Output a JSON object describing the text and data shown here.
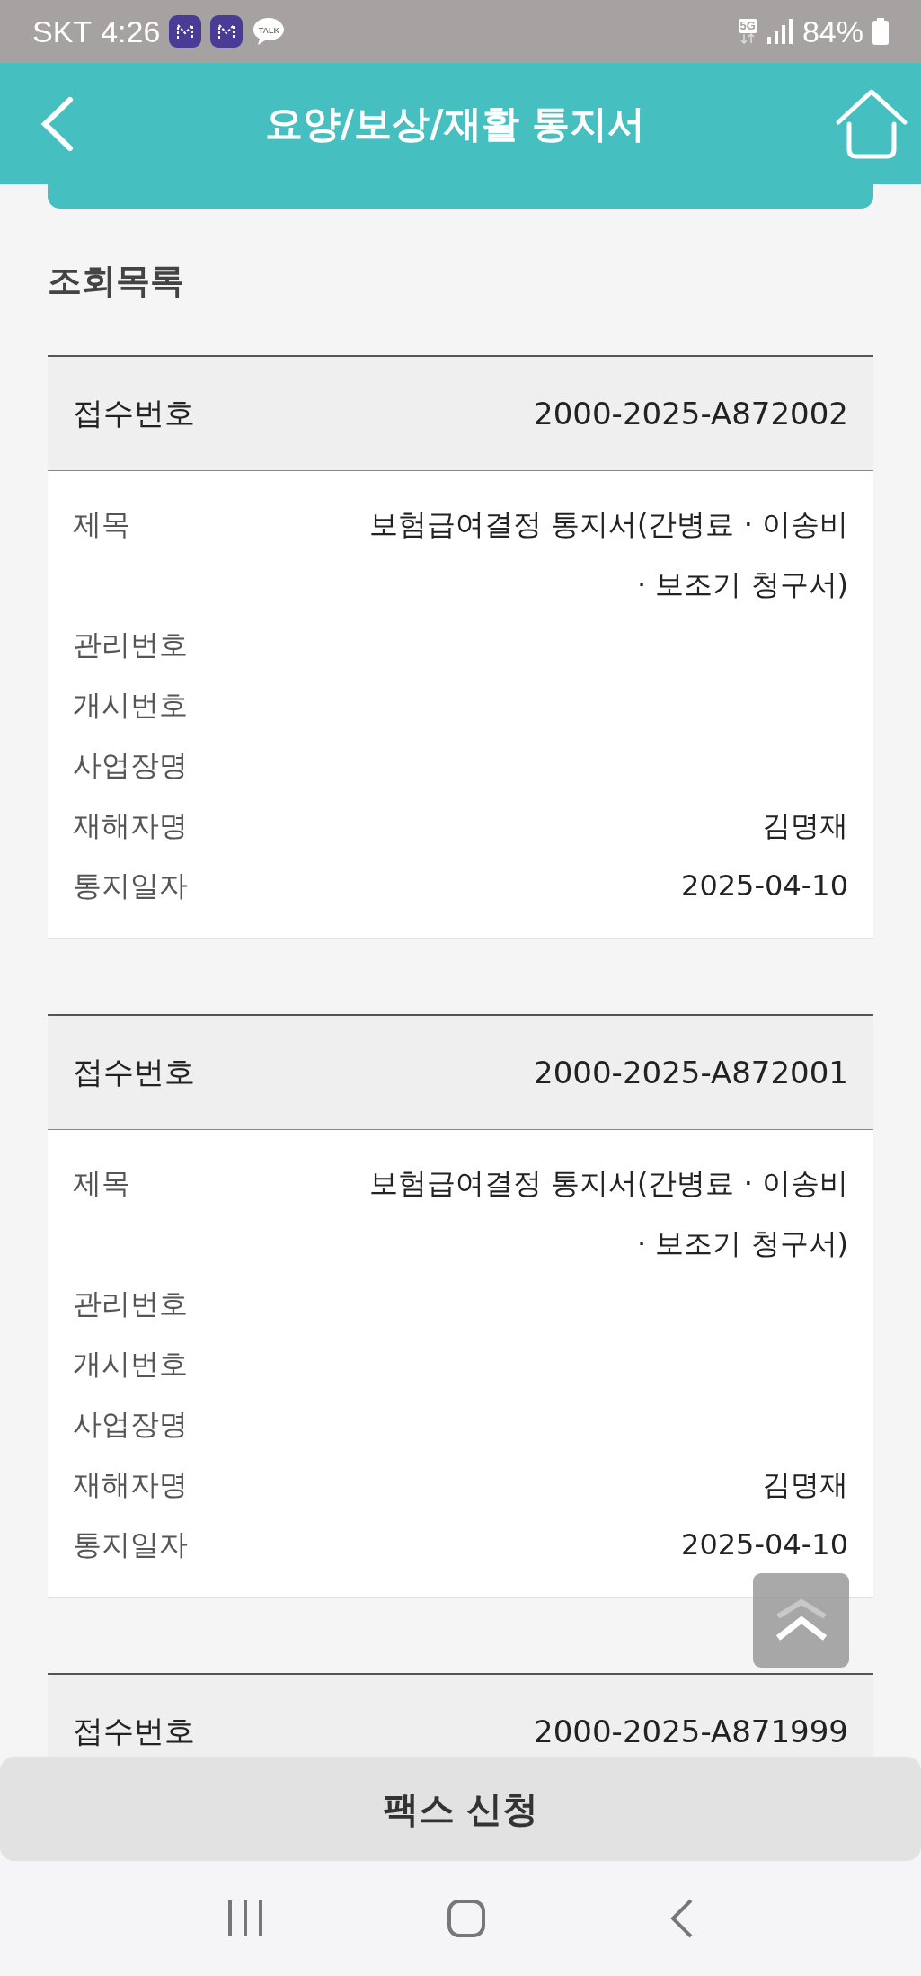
{
  "status_bar": {
    "carrier": "SKT",
    "time": "4:26",
    "chat_badge": "TALK",
    "network": "5G",
    "battery": "84%"
  },
  "header": {
    "title": "요양/보상/재활 통지서"
  },
  "list_title": "조회목록",
  "cards": [
    {
      "header_label": "접수번호",
      "header_value": "2000-2025-A872002",
      "fields": [
        {
          "label": "제목",
          "value": "보험급여결정 통지서(간병료 · 이송비 · 보조기 청구서)"
        },
        {
          "label": "관리번호"
        },
        {
          "label": "개시번호"
        },
        {
          "label": "사업장명"
        },
        {
          "label": "재해자명",
          "value": "김명재"
        },
        {
          "label": "통지일자",
          "value": "2025-04-10"
        }
      ]
    },
    {
      "header_label": "접수번호",
      "header_value": "2000-2025-A872001",
      "fields": [
        {
          "label": "제목",
          "value": "보험급여결정 통지서(간병료 · 이송비 · 보조기 청구서)"
        },
        {
          "label": "관리번호"
        },
        {
          "label": "개시번호"
        },
        {
          "label": "사업장명"
        },
        {
          "label": "재해자명",
          "value": "김명재"
        },
        {
          "label": "통지일자",
          "value": "2025-04-10"
        }
      ]
    },
    {
      "header_label": "접수번호",
      "header_value": "2000-2025-A871999"
    }
  ],
  "fax_button": "팩스 신청"
}
